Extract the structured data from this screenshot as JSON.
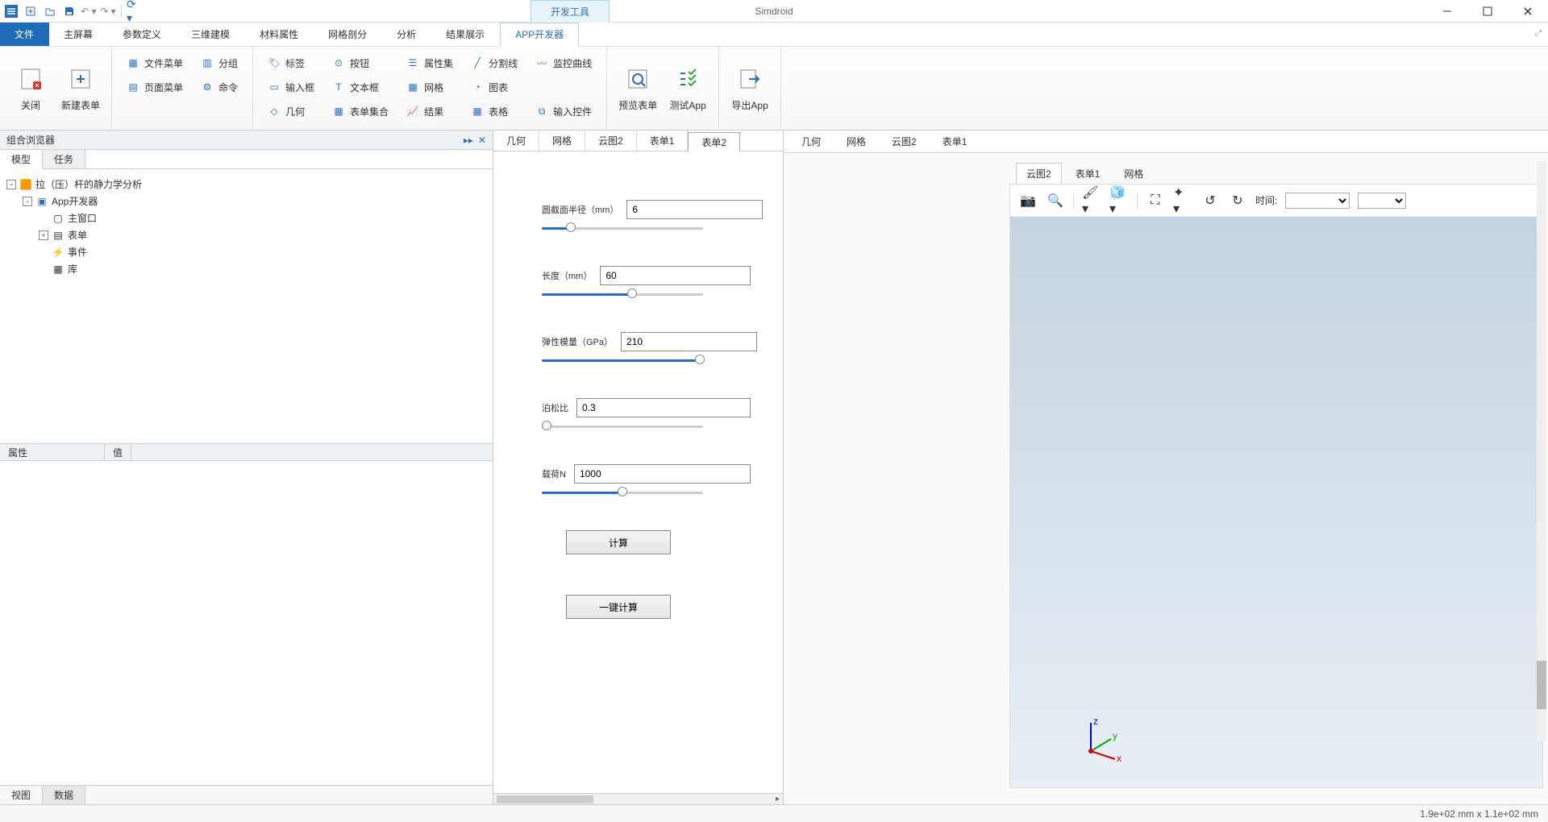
{
  "titlebar": {
    "devtool_tab": "开发工具",
    "app_title": "Simdroid"
  },
  "menubar": {
    "file": "文件",
    "items": [
      "主屏幕",
      "参数定义",
      "三维建模",
      "材料属性",
      "网格剖分",
      "分析",
      "结果展示",
      "APP开发器"
    ]
  },
  "ribbon": {
    "close": "关闭",
    "new_form": "新建表单",
    "file_menu": "文件菜单",
    "page_menu": "页面菜单",
    "group": "分组",
    "command": "命令",
    "label": "标签",
    "input": "输入框",
    "geometry": "几何",
    "button": "按钮",
    "textbox": "文本框",
    "form_set": "表单集合",
    "prop_set": "属性集",
    "mesh": "网格",
    "result": "结果",
    "divider": "分割线",
    "chart": "图表",
    "table": "表格",
    "monitor_curve": "监控曲线",
    "input_widget": "输入控件",
    "preview_form": "预览表单",
    "test_app": "测试App",
    "export_app": "导出App"
  },
  "left_panel": {
    "header": "组合浏览器",
    "tabs": [
      "模型",
      "任务"
    ],
    "tree": {
      "root": "拉（压）杆的静力学分析",
      "app_dev": "App开发器",
      "main_window": "主窗口",
      "form": "表单",
      "event": "事件",
      "library": "库"
    },
    "prop_cols": [
      "属性",
      "值"
    ],
    "bottom_tabs": [
      "视图",
      "数据"
    ]
  },
  "center": {
    "tabs": [
      "几何",
      "网格",
      "云图2",
      "表单1",
      "表单2"
    ],
    "fields": [
      {
        "label": "圆截面半径（mm）",
        "value": "6",
        "fill": 18
      },
      {
        "label": "长度（mm）",
        "value": "60",
        "fill": 56
      },
      {
        "label": "弹性模量（GPa）",
        "value": "210",
        "fill": 98
      },
      {
        "label": "泊松比",
        "value": "0.3",
        "fill": 3
      },
      {
        "label": "载荷N",
        "value": "1000",
        "fill": 50
      }
    ],
    "btn_calc": "计算",
    "btn_onekey": "一键计算"
  },
  "right": {
    "tabs": [
      "几何",
      "网格",
      "云图2",
      "表单1"
    ],
    "sub_tabs": [
      "云图2",
      "表单1",
      "网格"
    ],
    "time_label": "时间:"
  },
  "status": {
    "coords": "1.9e+02 mm x 1.1e+02 mm"
  }
}
